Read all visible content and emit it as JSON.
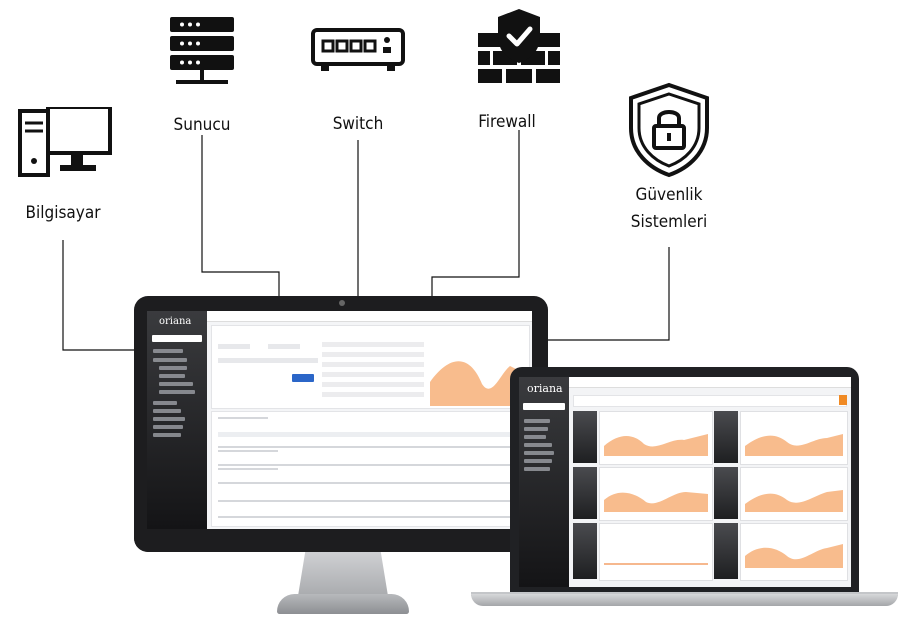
{
  "labels": {
    "bilgisayar": "Bilgisayar",
    "sunucu": "Sunucu",
    "switch": "Switch",
    "firewall": "Firewall",
    "guvenlik_line1": "Güvenlik",
    "guvenlik_line2": "Sistemleri"
  },
  "monitor_app": {
    "brand": "oriana"
  },
  "laptop_app": {
    "brand": "oriana"
  },
  "colors": {
    "accent": "#f7b079",
    "button": "#2b66c8",
    "sidebar": "#2a2b2e"
  }
}
